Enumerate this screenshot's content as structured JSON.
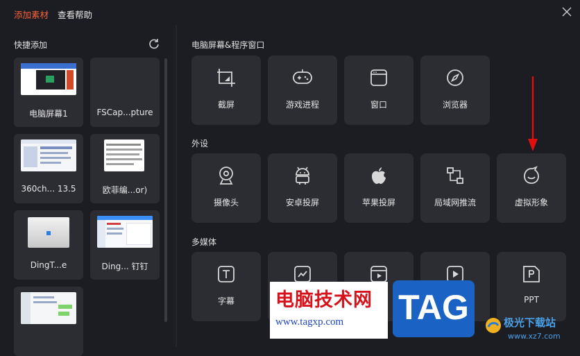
{
  "titlebar": {
    "tab_add": "添加素材",
    "tab_help": "查看帮助"
  },
  "quick": {
    "title": "快捷添加",
    "items": [
      {
        "label": "电脑屏幕1"
      },
      {
        "label": "FSCap...pture"
      },
      {
        "label": "360ch... 13.5"
      },
      {
        "label": "欧菲编...or)"
      },
      {
        "label": "DingT...e"
      },
      {
        "label": "Ding... 钉钉"
      },
      {
        "label": ""
      }
    ]
  },
  "sections": {
    "screen": {
      "title": "电脑屏幕&程序窗口",
      "items": [
        {
          "label": "截屏",
          "icon": "crop-icon"
        },
        {
          "label": "游戏进程",
          "icon": "gamepad-icon"
        },
        {
          "label": "窗口",
          "icon": "window-icon"
        },
        {
          "label": "浏览器",
          "icon": "compass-icon"
        }
      ]
    },
    "device": {
      "title": "外设",
      "items": [
        {
          "label": "摄像头",
          "icon": "webcam-icon"
        },
        {
          "label": "安卓投屏",
          "icon": "android-icon"
        },
        {
          "label": "苹果投屏",
          "icon": "apple-icon"
        },
        {
          "label": "局域网推流",
          "icon": "network-icon"
        },
        {
          "label": "虚拟形象",
          "icon": "avatar-icon"
        }
      ]
    },
    "media": {
      "title": "多媒体",
      "items": [
        {
          "label": "字幕",
          "icon": "text-icon"
        },
        {
          "label": "",
          "icon": "chart-icon"
        },
        {
          "label": "",
          "icon": "video-icon"
        },
        {
          "label": "",
          "icon": "play-icon"
        },
        {
          "label": "PPT",
          "icon": "ppt-icon"
        }
      ]
    }
  },
  "watermark": {
    "brand": "电脑技术网",
    "url": "www.tagxp.com",
    "tag": "TAG",
    "site": "极光下载站",
    "site_url": "www.xz7.com"
  },
  "colors": {
    "accent": "#f4623a",
    "background": "#1c1d22",
    "card": "#2c2d33",
    "arrow": "#e01010"
  }
}
